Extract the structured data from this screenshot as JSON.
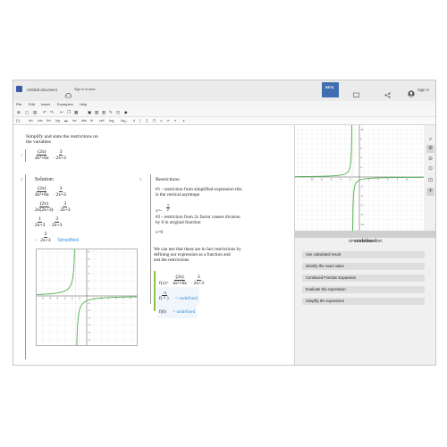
{
  "titlebar": {
    "doc_title": "Untitled document",
    "sign_in_to_save": "Sign in to save",
    "beta_badge": "BETA",
    "sign_in": "Sign in"
  },
  "menu": [
    "File",
    "Edit",
    "Insert",
    "Examples",
    "Help"
  ],
  "toolbar2": [
    "sin",
    "cos",
    "lim",
    "log",
    "inv",
    "abs",
    "flr",
    "ceil",
    "log₂",
    "log₁₀",
    "d",
    "∫",
    "∑",
    "∏",
    "∞",
    "π",
    "e"
  ],
  "doc": {
    "prompt_line1": "Simplify and state the restrictions on",
    "prompt_line2": "the variables",
    "line1_num": "1",
    "line2_num": "2",
    "line3_num": "3",
    "expr1": {
      "a_num": "(2x)",
      "a_den": "4x²+6x",
      "b_num": "3",
      "b_den": "2x+3"
    },
    "solution_label": "Solution:",
    "sol_step1": {
      "a_num": "(2x)",
      "a_den": "4x²+6x",
      "b_num": "3",
      "b_den": "2x+3"
    },
    "sol_step2": {
      "a_num": "(2x)",
      "a_den": "2x(2x+3)",
      "b_num": "3",
      "b_den": "2x+3"
    },
    "sol_step3": {
      "a_num": "1",
      "a_den": "2x+3",
      "b_num": "3",
      "b_den": "2x+3"
    },
    "sol_step4": {
      "sign": "-",
      "num": "2",
      "den": "2x+3",
      "label": "Simplified"
    },
    "restrictions_label": "Restrictions:",
    "restriction1_line1": "#1 - restriction from simplified expression this",
    "restriction1_line2": "is the vertical asymtope",
    "r1_eq_lhs": "x=-",
    "r1_eq_num": "3",
    "r1_eq_den": "2",
    "restriction2_line1": "#2 - restriction from 2x factor causes division",
    "restriction2_line2": "by 0 in original function",
    "r2_eq": "x=0",
    "test_line1": "We can test that these are in fact restrictions by",
    "test_line2": "defining our expression as a function and",
    "test_line3": "test the restrictions",
    "func_def": {
      "lhs": "f(x)=",
      "a_num": "(2x)",
      "a_den": "4x²+6x",
      "b_num": "3",
      "b_den": "2x+3"
    },
    "func_eval1": {
      "lhs": "f",
      "arg_num": "-3",
      "arg_den": "2",
      "result": "= undefined"
    },
    "func_eval2": {
      "lhs": "f(0)",
      "result": "= undefined"
    }
  },
  "graph_small": {
    "x_ticks": [
      "-6",
      "-5",
      "-4",
      "-3",
      "-2",
      "-1",
      "1",
      "2",
      "3",
      "4",
      "5",
      "6"
    ],
    "y_ticks": [
      "6",
      "5",
      "4",
      "3",
      "2",
      "1",
      "-1",
      "-2",
      "-3",
      "-4",
      "-5",
      "-6"
    ]
  },
  "graph_right": {
    "x_ticks": [
      "-10",
      "-8",
      "-6",
      "-4",
      "-2",
      "2",
      "4",
      "6",
      "8",
      "10"
    ],
    "y_ticks": [
      "10",
      "8",
      "6",
      "4",
      "2",
      "-2",
      "-4",
      "-6",
      "-8",
      "-10"
    ]
  },
  "operations": {
    "header": "OPERATIONS FOR:",
    "value": "undefined",
    "buttons": [
      "Use calculated result",
      "Identify the exact value",
      "Continued Fraction Expansion",
      "Evaluate the expression",
      "Simplify the expression"
    ]
  },
  "colors": {
    "curve": "#4caf50",
    "accent": "#3c8fd8",
    "beta_bg": "#3f6db0"
  },
  "icons": [
    "user-icon",
    "share-icon",
    "bookmark-icon",
    "zoom-in-icon",
    "zoom-out-icon",
    "lock-icon",
    "crosshair-icon",
    "cloud-icon"
  ]
}
